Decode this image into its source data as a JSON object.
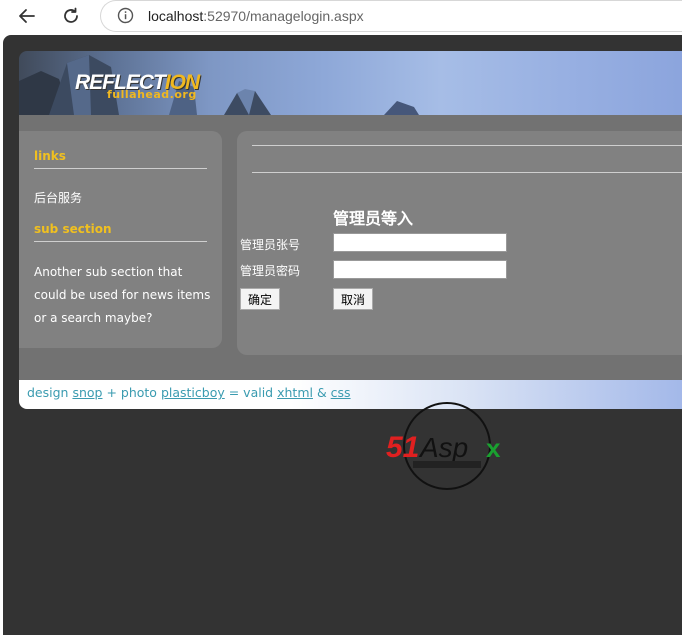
{
  "browser": {
    "url_host": "localhost",
    "url_rest": ":52970/managelogin.aspx",
    "icons": [
      "back-arrow-icon",
      "reload-icon",
      "site-info-icon"
    ]
  },
  "banner": {
    "logo_main": "REFLECT",
    "logo_accent": "ION",
    "logo_sub": "fullahead.org"
  },
  "sidebar": {
    "links_title": "links",
    "links": [
      "后台服务"
    ],
    "sub_title": "sub section",
    "sub_text": "Another sub section that could be used for news items or a search maybe?"
  },
  "login": {
    "title": "管理员等入",
    "account_label": "管理员张号",
    "account_value": "",
    "password_label": "管理员密码",
    "password_value": "",
    "ok_label": "确定",
    "cancel_label": "取消"
  },
  "footer": {
    "t1": "design ",
    "l1": "snop",
    "t2": " + photo ",
    "l2": "plasticboy",
    "t3": " = valid ",
    "l3": "xhtml",
    "t4": " & ",
    "l4": "css"
  },
  "watermark": {
    "text_red": "51",
    "text_dark": "Asp",
    "text_green": "x"
  },
  "colors": {
    "page_bg": "#333333",
    "accent_yellow": "#f0c020",
    "footer_link": "#3a9bb0"
  }
}
